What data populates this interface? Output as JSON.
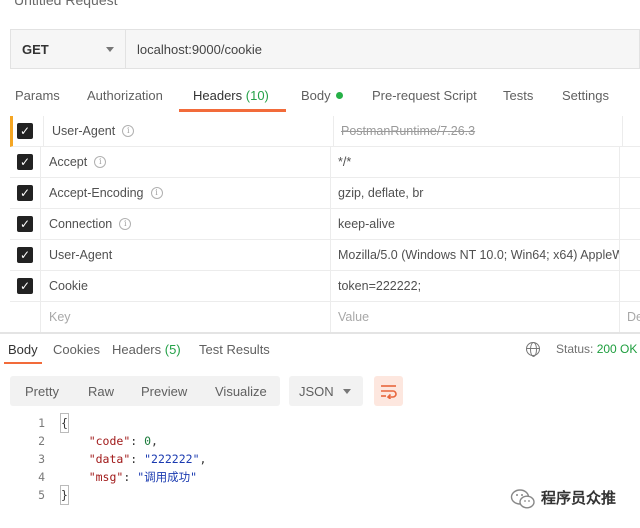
{
  "request": {
    "title": "Untitled Request",
    "method": "GET",
    "url": "localhost:9000/cookie"
  },
  "tabs": [
    {
      "label": "Params"
    },
    {
      "label": "Authorization"
    },
    {
      "label": "Headers",
      "count": "(10)"
    },
    {
      "label": "Body"
    },
    {
      "label": "Pre-request Script"
    },
    {
      "label": "Tests"
    },
    {
      "label": "Settings"
    }
  ],
  "headers": [
    {
      "key": "User-Agent",
      "value": "PostmanRuntime/7.26.3",
      "checked": true,
      "info": true
    },
    {
      "key": "Accept",
      "value": "*/*",
      "checked": true,
      "info": true
    },
    {
      "key": "Accept-Encoding",
      "value": "gzip, deflate, br",
      "checked": true,
      "info": true
    },
    {
      "key": "Connection",
      "value": "keep-alive",
      "checked": true,
      "info": true
    },
    {
      "key": "User-Agent",
      "value": "Mozilla/5.0 (Windows NT 10.0; Win64; x64) AppleW",
      "checked": true,
      "info": false
    },
    {
      "key": "Cookie",
      "value": "token=222222;",
      "checked": true,
      "info": false
    }
  ],
  "header_placeholders": {
    "key": "Key",
    "value": "Value",
    "description": "De"
  },
  "response": {
    "tabs": [
      {
        "label": "Body"
      },
      {
        "label": "Cookies"
      },
      {
        "label": "Headers",
        "count": "(5)"
      },
      {
        "label": "Test Results"
      }
    ],
    "status_label": "Status:",
    "status_value": "200 OK",
    "view_tabs": [
      "Pretty",
      "Raw",
      "Preview",
      "Visualize"
    ],
    "format": "JSON",
    "code_lines": [
      {
        "n": "1",
        "text": "{"
      },
      {
        "n": "2",
        "key": "\"code\"",
        "sep": ": ",
        "value": "0",
        "tail": ","
      },
      {
        "n": "3",
        "key": "\"data\"",
        "sep": ": ",
        "value": "\"222222\"",
        "tail": ","
      },
      {
        "n": "4",
        "key": "\"msg\"",
        "sep": ": ",
        "value": "\"调用成功\"",
        "tail": ""
      },
      {
        "n": "5",
        "text": "}"
      }
    ]
  },
  "watermark": "程序员众推"
}
